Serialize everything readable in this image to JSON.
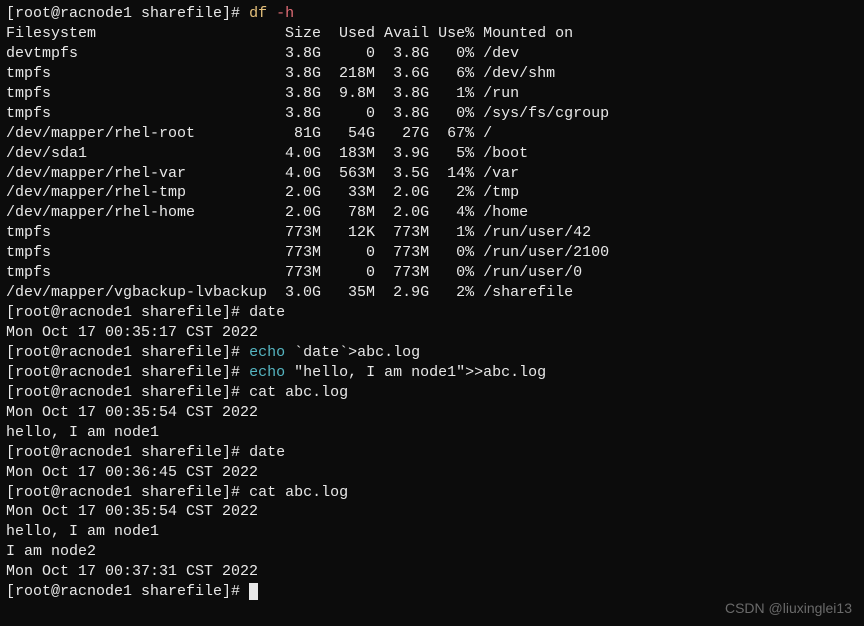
{
  "prompt": {
    "user": "root",
    "host": "racnode1",
    "dir": "sharefile",
    "symbol": "#",
    "full": "[root@racnode1 sharefile]#"
  },
  "commands": {
    "df": "df",
    "df_opt": "-h",
    "date1": "date",
    "echo": "echo",
    "echo_arg1": "`date`>abc.log",
    "echo_arg2": "\"hello, I am node1\">>abc.log",
    "cat": "cat abc.log",
    "date2": "date"
  },
  "df_output": {
    "header": {
      "fs": "Filesystem",
      "size": "Size",
      "used": "Used",
      "avail": "Avail",
      "usep": "Use%",
      "mount": "Mounted on"
    },
    "rows": [
      {
        "fs": "devtmpfs",
        "size": "3.8G",
        "used": "0",
        "avail": "3.8G",
        "usep": "0%",
        "mount": "/dev"
      },
      {
        "fs": "tmpfs",
        "size": "3.8G",
        "used": "218M",
        "avail": "3.6G",
        "usep": "6%",
        "mount": "/dev/shm"
      },
      {
        "fs": "tmpfs",
        "size": "3.8G",
        "used": "9.8M",
        "avail": "3.8G",
        "usep": "1%",
        "mount": "/run"
      },
      {
        "fs": "tmpfs",
        "size": "3.8G",
        "used": "0",
        "avail": "3.8G",
        "usep": "0%",
        "mount": "/sys/fs/cgroup"
      },
      {
        "fs": "/dev/mapper/rhel-root",
        "size": "81G",
        "used": "54G",
        "avail": "27G",
        "usep": "67%",
        "mount": "/"
      },
      {
        "fs": "/dev/sda1",
        "size": "4.0G",
        "used": "183M",
        "avail": "3.9G",
        "usep": "5%",
        "mount": "/boot"
      },
      {
        "fs": "/dev/mapper/rhel-var",
        "size": "4.0G",
        "used": "563M",
        "avail": "3.5G",
        "usep": "14%",
        "mount": "/var"
      },
      {
        "fs": "/dev/mapper/rhel-tmp",
        "size": "2.0G",
        "used": "33M",
        "avail": "2.0G",
        "usep": "2%",
        "mount": "/tmp"
      },
      {
        "fs": "/dev/mapper/rhel-home",
        "size": "2.0G",
        "used": "78M",
        "avail": "2.0G",
        "usep": "4%",
        "mount": "/home"
      },
      {
        "fs": "tmpfs",
        "size": "773M",
        "used": "12K",
        "avail": "773M",
        "usep": "1%",
        "mount": "/run/user/42"
      },
      {
        "fs": "tmpfs",
        "size": "773M",
        "used": "0",
        "avail": "773M",
        "usep": "0%",
        "mount": "/run/user/2100"
      },
      {
        "fs": "tmpfs",
        "size": "773M",
        "used": "0",
        "avail": "773M",
        "usep": "0%",
        "mount": "/run/user/0"
      },
      {
        "fs": "/dev/mapper/vgbackup-lvbackup",
        "size": "3.0G",
        "used": "35M",
        "avail": "2.9G",
        "usep": "2%",
        "mount": "/sharefile"
      }
    ]
  },
  "outputs": {
    "date1": "Mon Oct 17 00:35:17 CST 2022",
    "cat1_line1": "Mon Oct 17 00:35:54 CST 2022",
    "cat1_line2": "hello, I am node1",
    "date2": "Mon Oct 17 00:36:45 CST 2022",
    "cat2_line1": "Mon Oct 17 00:35:54 CST 2022",
    "cat2_line2": "hello, I am node1",
    "cat2_line3": "I am node2",
    "cat2_line4": "Mon Oct 17 00:37:31 CST 2022"
  },
  "watermark": "CSDN @liuxinglei13"
}
